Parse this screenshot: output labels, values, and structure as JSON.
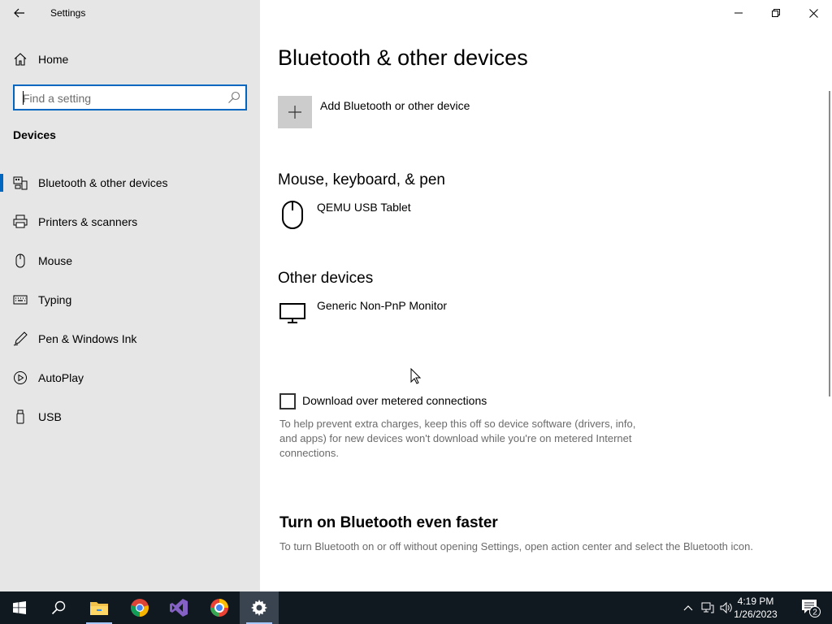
{
  "app": {
    "title": "Settings"
  },
  "sidebar": {
    "home_label": "Home",
    "search": {
      "placeholder": "Find a setting",
      "value": ""
    },
    "section_title": "Devices",
    "items": [
      {
        "label": "Bluetooth & other devices",
        "icon": "bluetooth-devices-icon",
        "selected": true
      },
      {
        "label": "Printers & scanners",
        "icon": "printer-icon",
        "selected": false
      },
      {
        "label": "Mouse",
        "icon": "mouse-icon",
        "selected": false
      },
      {
        "label": "Typing",
        "icon": "keyboard-icon",
        "selected": false
      },
      {
        "label": "Pen & Windows Ink",
        "icon": "pen-icon",
        "selected": false
      },
      {
        "label": "AutoPlay",
        "icon": "autoplay-icon",
        "selected": false
      },
      {
        "label": "USB",
        "icon": "usb-icon",
        "selected": false
      }
    ]
  },
  "main": {
    "title": "Bluetooth & other devices",
    "add_device_label": "Add Bluetooth or other device",
    "groups": [
      {
        "title": "Mouse, keyboard, & pen",
        "devices": [
          {
            "name": "QEMU USB Tablet",
            "icon": "mouse-icon"
          }
        ]
      },
      {
        "title": "Other devices",
        "devices": [
          {
            "name": "Generic Non-PnP Monitor",
            "icon": "monitor-icon"
          }
        ]
      }
    ],
    "metered": {
      "label": "Download over metered connections",
      "checked": false,
      "help": "To help prevent extra charges, keep this off so device software (drivers, info, and apps) for new devices won't download while you're on metered Internet connections."
    },
    "faster": {
      "title": "Turn on Bluetooth even faster",
      "text": "To turn Bluetooth on or off without opening Settings, open action center and select the Bluetooth icon."
    }
  },
  "taskbar": {
    "apps": [
      "start-icon",
      "search-icon",
      "file-explorer-icon",
      "chrome-icon",
      "visual-studio-icon",
      "browser-icon",
      "settings-icon"
    ],
    "active_app": "settings-icon",
    "time": "4:19 PM",
    "date": "1/26/2023",
    "notification_count": "2"
  },
  "colors": {
    "accent": "#0067c0",
    "sidebar_bg": "#e6e6e6",
    "taskbar_bg": "#101820"
  }
}
